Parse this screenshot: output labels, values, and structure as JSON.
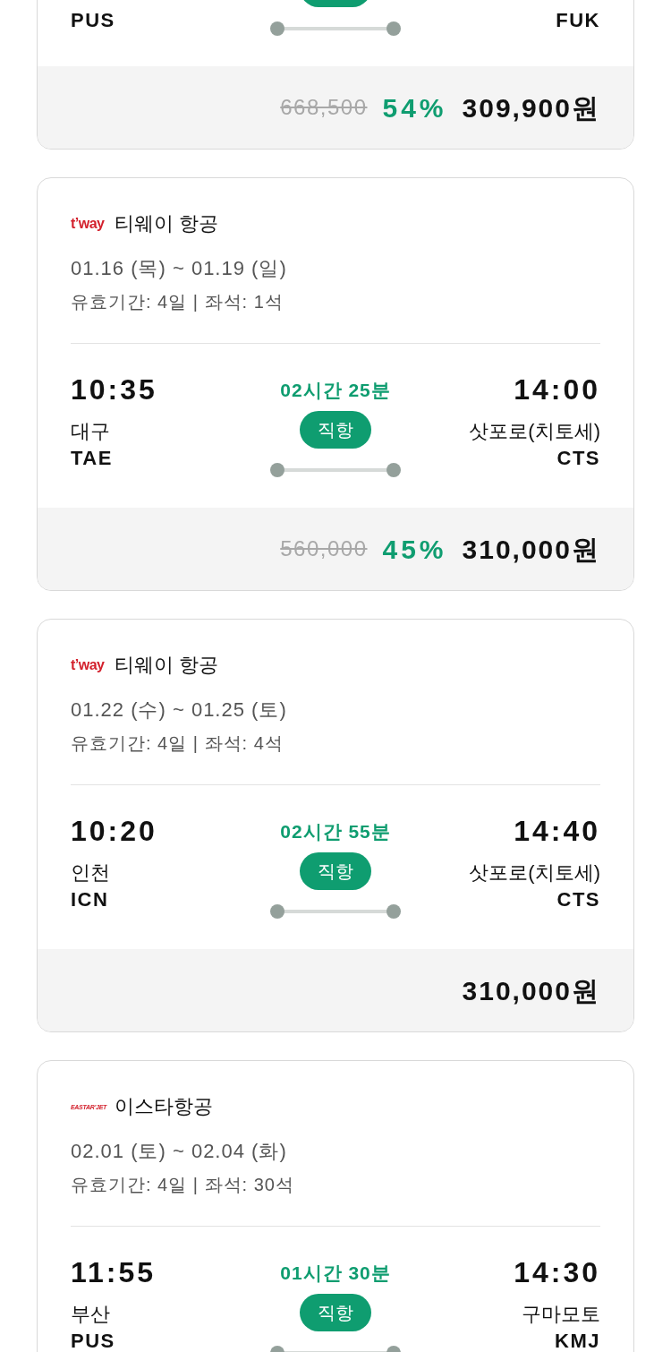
{
  "flights": [
    {
      "kind": "cut_top",
      "departure": {
        "code": "PUS"
      },
      "arrival": {
        "code": "FUK"
      },
      "price": {
        "original": "668,500",
        "discount": "54%",
        "final": "309,900원"
      }
    },
    {
      "kind": "full",
      "airline": {
        "logo": {
          "kind": "tway",
          "text": "t’way"
        },
        "name": "티웨이 항공"
      },
      "dates": "01.16 (목) ~ 01.19 (일)",
      "validity": "유효기간: 4일 | 좌석: 1석",
      "departure": {
        "time": "10:35",
        "city": "대구",
        "code": "TAE"
      },
      "duration": "02시간 25분",
      "badge": "직항",
      "arrival": {
        "time": "14:00",
        "city": "삿포로(치토세)",
        "code": "CTS"
      },
      "price": {
        "original": "560,000",
        "discount": "45%",
        "final": "310,000원"
      }
    },
    {
      "kind": "full",
      "airline": {
        "logo": {
          "kind": "tway",
          "text": "t’way"
        },
        "name": "티웨이 항공"
      },
      "dates": "01.22 (수) ~ 01.25 (토)",
      "validity": "유효기간: 4일 | 좌석: 4석",
      "departure": {
        "time": "10:20",
        "city": "인천",
        "code": "ICN"
      },
      "duration": "02시간 55분",
      "badge": "직항",
      "arrival": {
        "time": "14:40",
        "city": "삿포로(치토세)",
        "code": "CTS"
      },
      "price": {
        "final": "310,000원"
      }
    },
    {
      "kind": "full",
      "airline": {
        "logo": {
          "kind": "eastar",
          "text": "EASTAR’JET"
        },
        "name": "이스타항공"
      },
      "dates": "02.01 (토) ~ 02.04 (화)",
      "validity": "유효기간: 4일 | 좌석: 30석",
      "departure": {
        "time": "11:55",
        "city": "부산",
        "code": "PUS"
      },
      "duration": "01시간 30분",
      "badge": "직항",
      "arrival": {
        "time": "14:30",
        "city": "구마모토",
        "code": "KMJ"
      }
    }
  ]
}
